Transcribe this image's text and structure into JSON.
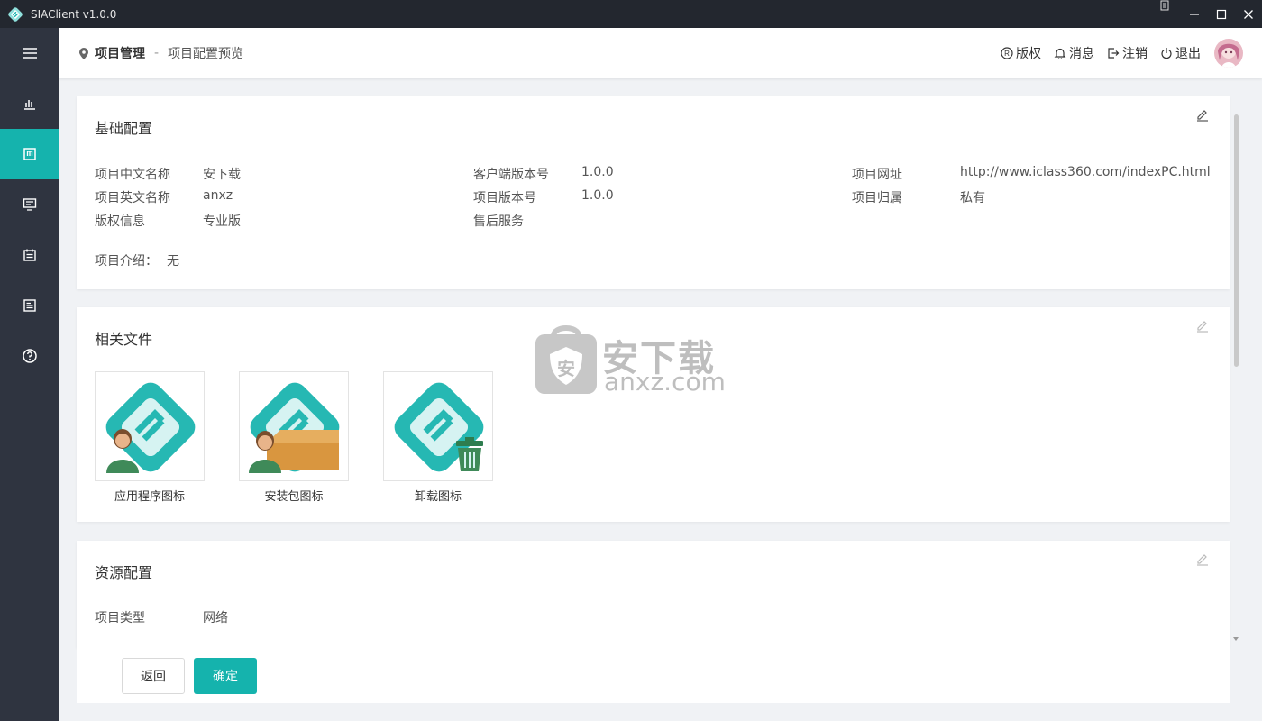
{
  "app": {
    "title": "SIAClient v1.0.0"
  },
  "window_controls": [
    "minimize",
    "maximize",
    "close"
  ],
  "sidebar": {
    "items": [
      {
        "icon": "menu-icon",
        "active": false
      },
      {
        "icon": "bar-chart-icon",
        "active": false
      },
      {
        "icon": "project-icon",
        "active": true
      },
      {
        "icon": "monitor-icon",
        "active": false
      },
      {
        "icon": "calendar-icon",
        "active": false
      },
      {
        "icon": "document-icon",
        "active": false
      },
      {
        "icon": "help-icon",
        "active": false
      }
    ]
  },
  "header": {
    "breadcrumb": {
      "main": "项目管理",
      "separator": "-",
      "sub": "项目配置预览"
    },
    "actions": {
      "copyright": "版权",
      "messages": "消息",
      "logout_account": "注销",
      "exit": "退出"
    }
  },
  "basic_config": {
    "title": "基础配置",
    "fields": {
      "cn_name_label": "项目中文名称",
      "cn_name_value": "安下载",
      "en_name_label": "项目英文名称",
      "en_name_value": "anxz",
      "copyright_label": "版权信息",
      "copyright_value": "专业版",
      "client_version_label": "客户端版本号",
      "client_version_value": "1.0.0",
      "project_version_label": "项目版本号",
      "project_version_value": "1.0.0",
      "after_sales_label": "售后服务",
      "after_sales_value": "",
      "website_label": "项目网址",
      "website_value": "http://www.iclass360.com/indexPC.html",
      "ownership_label": "项目归属",
      "ownership_value": "私有",
      "intro_label": "项目介绍：",
      "intro_value": "无"
    }
  },
  "related_files": {
    "title": "相关文件",
    "files": [
      {
        "caption": "应用程序图标"
      },
      {
        "caption": "安装包图标"
      },
      {
        "caption": "卸载图标"
      }
    ]
  },
  "resource_config": {
    "title": "资源配置",
    "type_label": "项目类型",
    "type_value": "网络"
  },
  "footer": {
    "back_label": "返回",
    "ok_label": "确定"
  },
  "watermark": {
    "text_cn": "安下载",
    "text_en": "anxz.com",
    "badge": "安"
  },
  "colors": {
    "accent": "#15b3ad",
    "sidebar": "#2f3440",
    "titlebar": "#23272f"
  }
}
